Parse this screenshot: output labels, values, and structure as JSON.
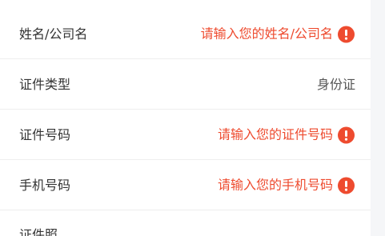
{
  "form": {
    "rows": [
      {
        "label": "姓名/公司名",
        "placeholder": "请输入您的姓名/公司名",
        "status_icon": "warning-icon"
      },
      {
        "label": "证件类型",
        "value": "身份证"
      },
      {
        "label": "证件号码",
        "placeholder": "请输入您的证件号码",
        "status_icon": "warning-icon"
      },
      {
        "label": "手机号码",
        "placeholder": "请输入您的手机号码",
        "status_icon": "warning-icon"
      },
      {
        "label": "证件照"
      }
    ]
  },
  "colors": {
    "error_red": "#ee4b2f",
    "label_text": "#333333",
    "value_text": "#555555",
    "divider": "#eeeeee",
    "gutter": "#f5f6f8"
  }
}
